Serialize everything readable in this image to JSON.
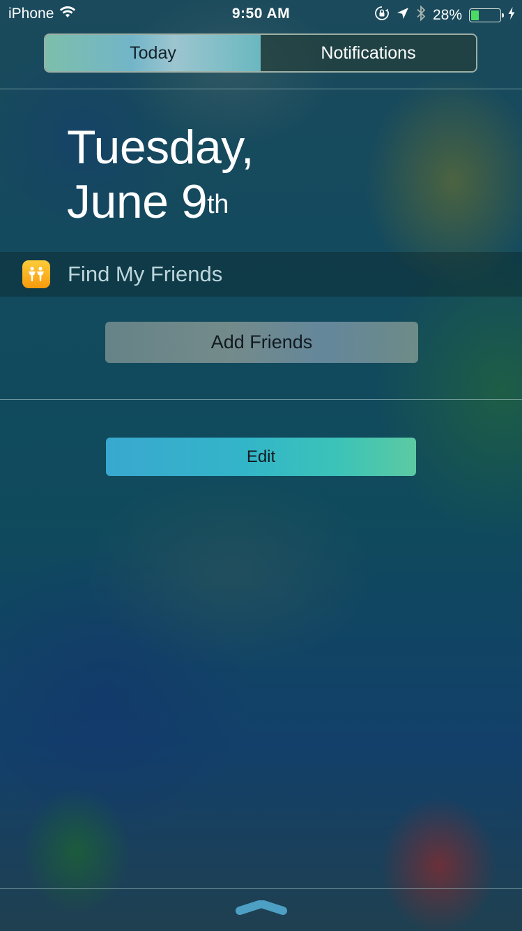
{
  "status_bar": {
    "carrier": "iPhone",
    "wifi_icon": "wifi-icon",
    "time": "9:50 AM",
    "rotation_lock_icon": "rotation-lock-icon",
    "location_icon": "location-arrow-icon",
    "bluetooth_icon": "bluetooth-icon",
    "battery_percent_label": "28%",
    "battery_level": 0.28,
    "charging_icon": "charging-bolt-icon",
    "battery_color": "#4cd964"
  },
  "segmented_control": {
    "tabs": [
      {
        "label": "Today",
        "selected": true
      },
      {
        "label": "Notifications",
        "selected": false
      }
    ]
  },
  "date_header": {
    "line1": "Tuesday,",
    "line2": "June 9",
    "ordinal": "th"
  },
  "widget": {
    "app_icon": "find-my-friends-icon",
    "title": "Find My Friends",
    "add_button_label": "Add Friends"
  },
  "edit_button_label": "Edit",
  "grabber_icon": "chevron-up-grabber-icon"
}
